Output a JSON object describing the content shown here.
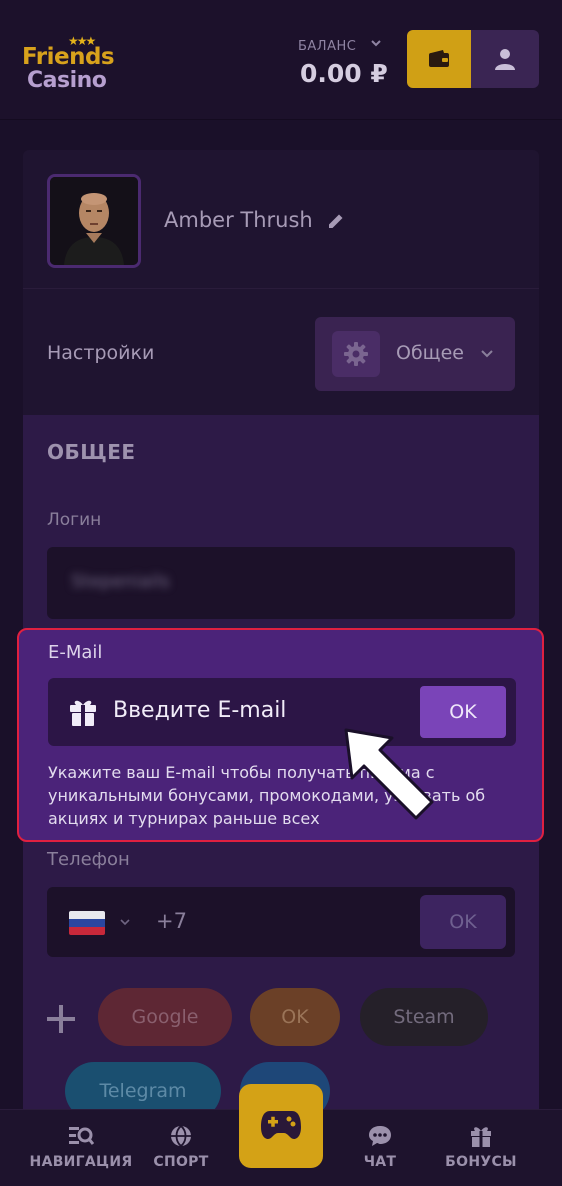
{
  "header": {
    "logo_line1": "Friends",
    "logo_line2": "Casino",
    "logo_stars": "★★★",
    "balance_label": "БАЛАНС",
    "balance_value": "0.00 ₽",
    "wallet_icon": "wallet-icon",
    "user_icon": "user-icon"
  },
  "profile": {
    "username": "Amber Thrush",
    "edit_icon": "pencil-icon",
    "settings_label": "Настройки",
    "settings_value": "Общее",
    "settings_icon": "gear-icon"
  },
  "general": {
    "title": "ОБЩЕЕ",
    "login_label": "Логин",
    "login_value": "Stepeniails",
    "email_label": "E-Mail",
    "email_placeholder": "Введите E-mail",
    "email_ok": "OK",
    "email_hint": "Укажите ваш E-mail чтобы получать письма с уникальными бонусами, промокодами, узнавать об акциях и турнирах раньше всех",
    "phone_label": "Телефон",
    "phone_code": "+7",
    "phone_ok": "OK",
    "socials": [
      "Google",
      "OK",
      "Steam",
      "Telegram"
    ]
  },
  "colors": {
    "accent_yellow": "#d4a216",
    "highlight_border": "#e02040",
    "email_bg": "#4b2379"
  },
  "bottom_nav": {
    "navigation": "НАВИГАЦИЯ",
    "sport": "СПОРТ",
    "chat": "ЧАТ",
    "bonuses": "БОНУСЫ"
  }
}
